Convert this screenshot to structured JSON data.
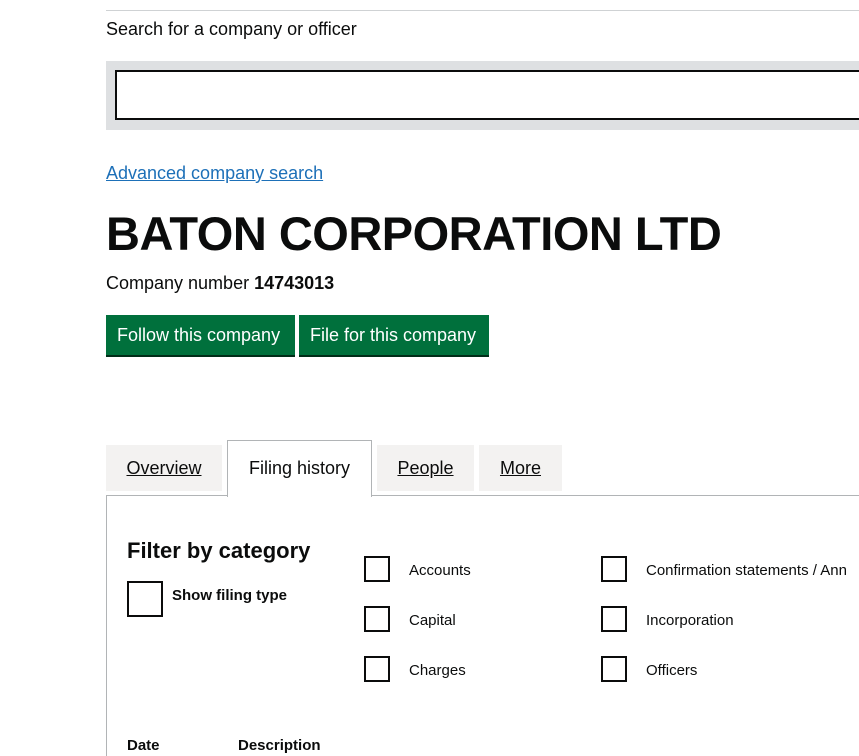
{
  "search": {
    "label": "Search for a company or officer",
    "value": "",
    "advanced_link": "Advanced company search"
  },
  "company": {
    "name": "BATON CORPORATION LTD",
    "number_label": "Company number",
    "number": "14743013"
  },
  "actions": {
    "follow": "Follow this company",
    "file": "File for this company"
  },
  "tabs": [
    {
      "label": "Overview",
      "active": false
    },
    {
      "label": "Filing history",
      "active": true
    },
    {
      "label": "People",
      "active": false
    },
    {
      "label": "More",
      "active": false
    }
  ],
  "filter": {
    "title": "Filter by category",
    "show_filing_type": "Show filing type",
    "categories": [
      {
        "label": "Accounts",
        "checked": false
      },
      {
        "label": "Confirmation statements / Ann",
        "checked": false
      },
      {
        "label": "Capital",
        "checked": false
      },
      {
        "label": "Incorporation",
        "checked": false
      },
      {
        "label": "Charges",
        "checked": false
      },
      {
        "label": "Officers",
        "checked": false
      }
    ]
  },
  "table": {
    "columns": [
      "Date",
      "Description"
    ]
  },
  "colors": {
    "button_green": "#00703c",
    "link_blue": "#1d70b8",
    "tab_grey": "#f3f2f1"
  }
}
